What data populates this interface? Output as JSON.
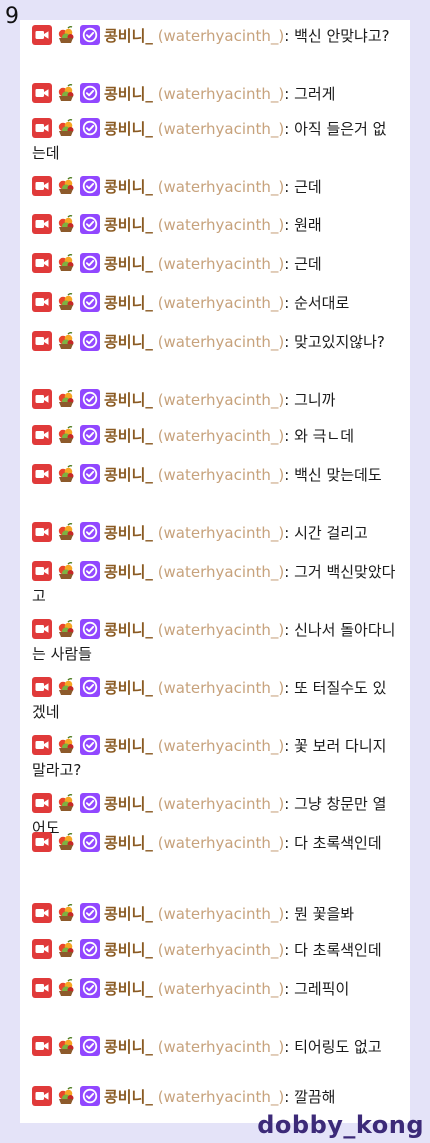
{
  "page_number": "9",
  "watermark": "dobby_kong",
  "user": {
    "name": "콩비니_",
    "id": "(waterhyacinth_)",
    "badges": [
      "camera-badge-icon",
      "fruit-basket-badge-icon",
      "verified-check-badge-icon"
    ]
  },
  "colors": {
    "background": "#e4e3f8",
    "username": "#8a5a22",
    "userid": "#c7a27c",
    "camera_badge": "#e03a3a",
    "verified_badge": "#9147ff",
    "watermark": "#3c2a78"
  },
  "messages": [
    {
      "text": "백신 안맞냐고?"
    },
    {
      "text": "그러게"
    },
    {
      "text": "아직 들은거 없는데"
    },
    {
      "text": "근데"
    },
    {
      "text": "원래"
    },
    {
      "text": "근데"
    },
    {
      "text": "순서대로"
    },
    {
      "text": "맞고있지않나?"
    },
    {
      "text": "그니까"
    },
    {
      "text": "와 극ㄴ데"
    },
    {
      "text": "백신 맞는데도"
    },
    {
      "text": "시간 걸리고"
    },
    {
      "text": "그거 백신맞았다고"
    },
    {
      "text": "신나서 돌아다니는 사람들"
    },
    {
      "text": "또 터질수도 있겠네"
    },
    {
      "text": "꽃 보러 다니지 말라고?"
    },
    {
      "text": "그냥 창문만 열어도"
    },
    {
      "text": "다 초록색인데"
    },
    {
      "text": "뭔 꽃을봐"
    },
    {
      "text": "다 초록색인데"
    },
    {
      "text": "그레픽이"
    },
    {
      "text": "티어링도 없고"
    },
    {
      "text": "깔끔해"
    }
  ]
}
